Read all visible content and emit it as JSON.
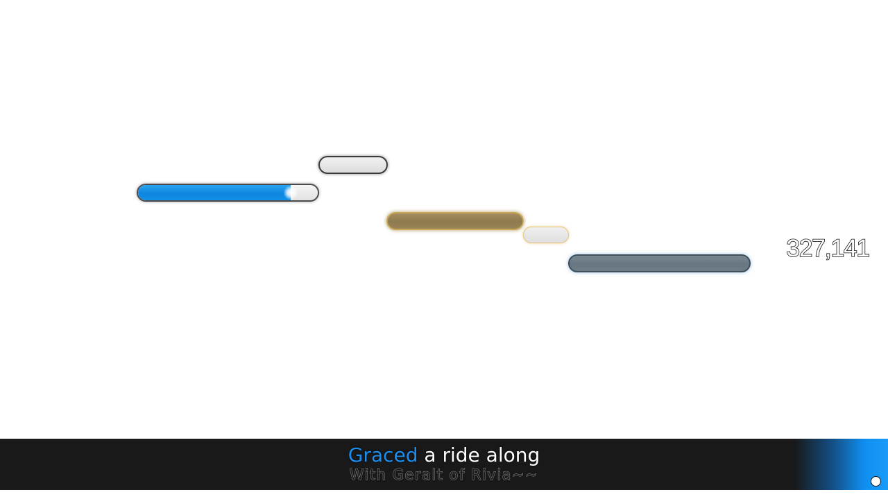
{
  "score": {
    "value": "327,141"
  },
  "lyrics": {
    "line1_sung": "Graced ",
    "line1_unsung": "a ride along",
    "line2": "With Geralt of Rivia~~"
  },
  "pitch_notes": [
    {
      "name": "note-1",
      "style": "blue",
      "progress": 0.85
    },
    {
      "name": "note-2",
      "style": "gray"
    },
    {
      "name": "note-3",
      "style": "gold"
    },
    {
      "name": "note-4",
      "style": "goldlight"
    },
    {
      "name": "note-5",
      "style": "slate"
    }
  ],
  "colors": {
    "sung_text": "#1b8ef0",
    "unsung_text": "#ffffff",
    "lyrics_bar": "#191919",
    "accent_blue": "#0f8ff0",
    "gold_note": "#9a8456",
    "slate_note": "#6f7d89"
  }
}
